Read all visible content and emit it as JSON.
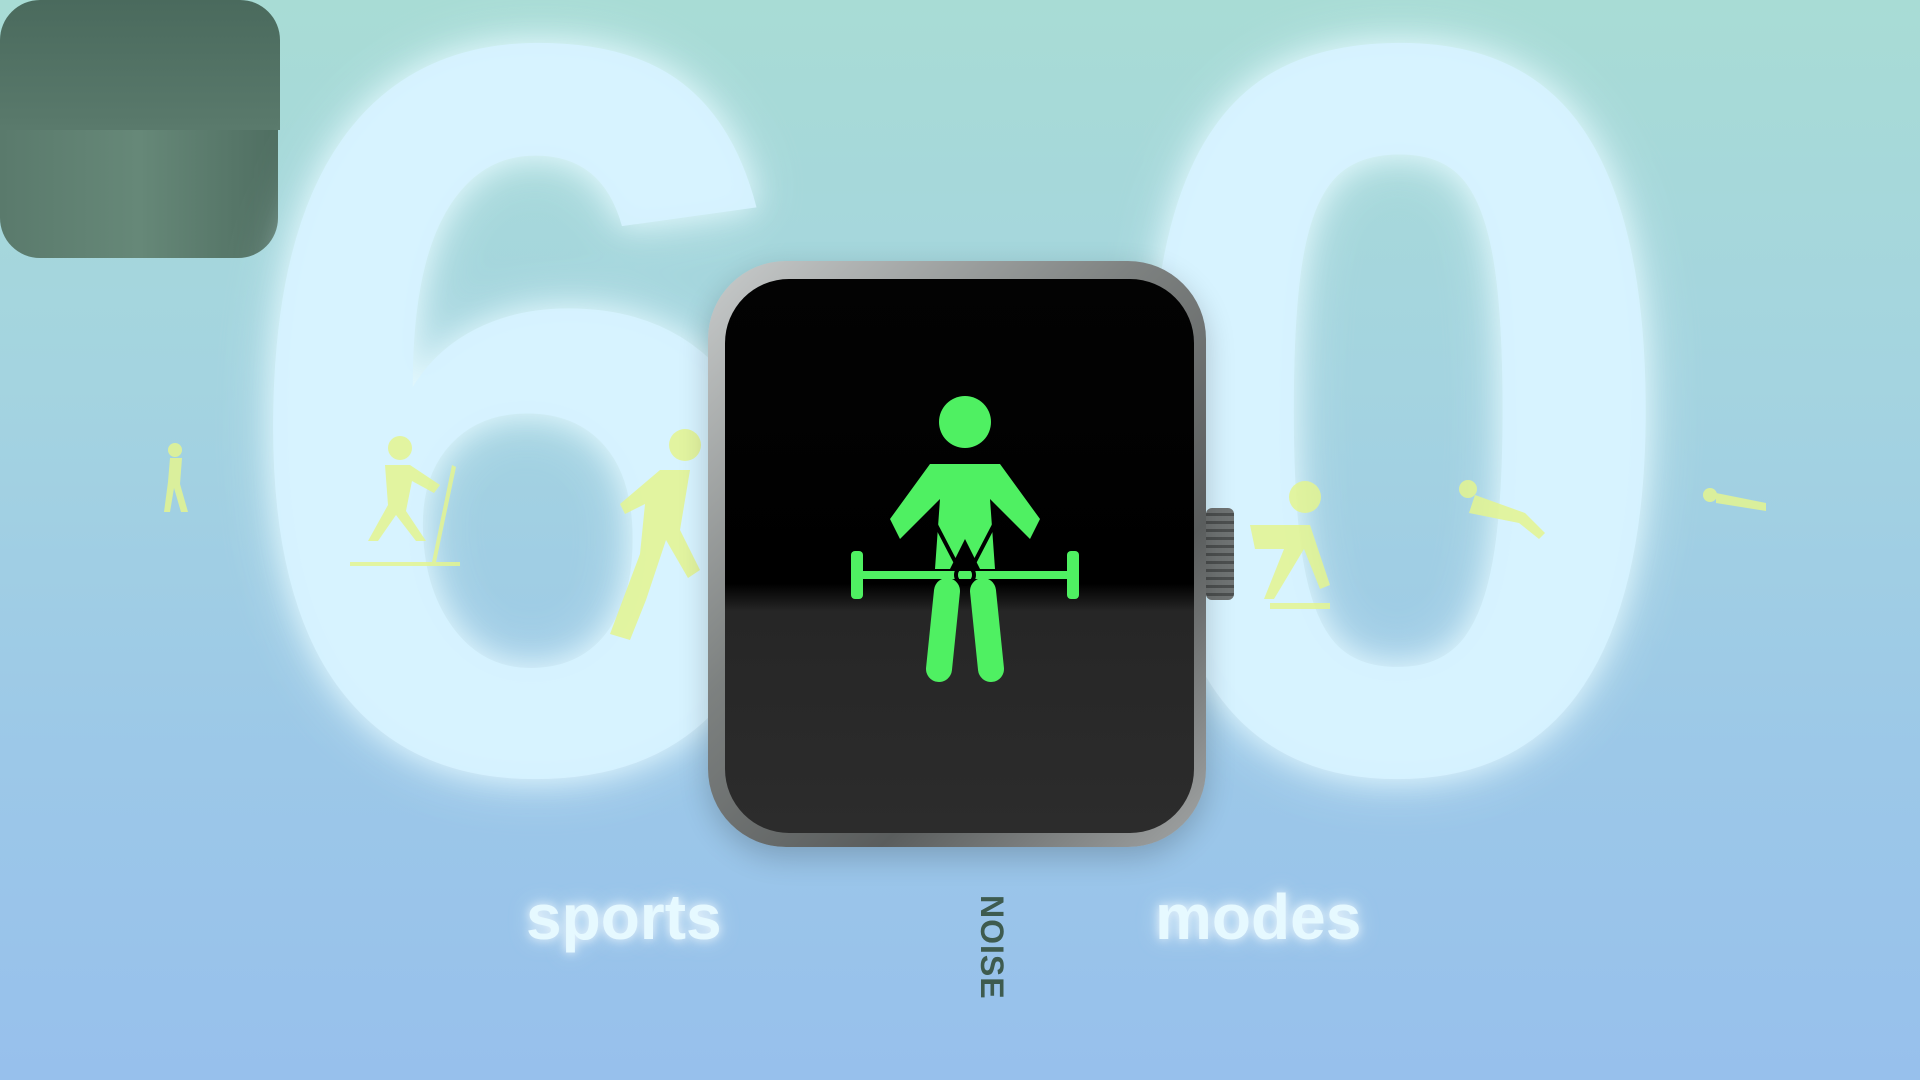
{
  "headline": {
    "number_first_digit": "6",
    "number_second_digit": "0",
    "word_left": "sports",
    "word_right": "modes"
  },
  "watch": {
    "brand": "NOISE",
    "screen_icon": "weightlifting-icon"
  },
  "colors": {
    "figure": "#4ff062",
    "sport_icons": "#e4f590",
    "strap": "#58796b"
  }
}
